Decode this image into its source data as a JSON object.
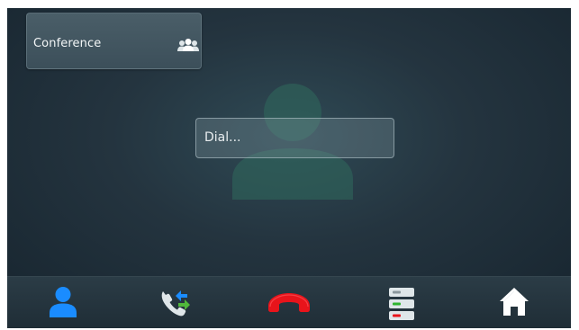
{
  "conference": {
    "label": "Conference",
    "icon": "group-icon"
  },
  "dial": {
    "placeholder": "Dial..."
  },
  "background": {
    "icon": "contact-silhouette-icon"
  },
  "bottom_nav": [
    {
      "name": "contacts",
      "icon": "person-icon",
      "color": "#1a8cff"
    },
    {
      "name": "transfer",
      "icon": "call-transfer-icon"
    },
    {
      "name": "hang-up",
      "icon": "hang-up-icon",
      "color": "#e8141b"
    },
    {
      "name": "menu",
      "icon": "status-list-icon"
    },
    {
      "name": "home",
      "icon": "home-icon"
    }
  ],
  "colors": {
    "background": "#24343f",
    "accent_blue": "#1a8cff",
    "hangup_red": "#e8141b",
    "status_green": "#2fb52f"
  }
}
